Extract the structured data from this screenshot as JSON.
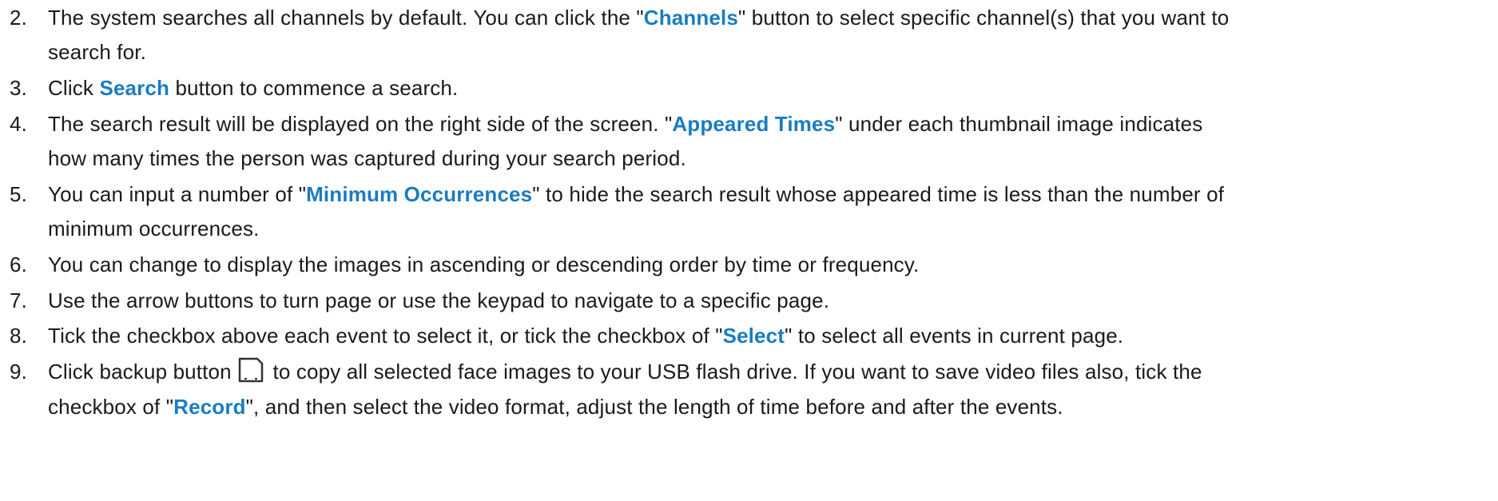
{
  "steps": [
    {
      "num": "2.",
      "a": "The system searches all channels by default. You can click the \"",
      "b": "Channels",
      "c": "\" button to select specific channel(s) that you want to",
      "d": "search for."
    },
    {
      "num": "3.",
      "a": "Click ",
      "b": "Search",
      "c": " button to commence a search."
    },
    {
      "num": "4.",
      "a": "The search result will be displayed on the right side of the screen. \"",
      "b": "Appeared Times",
      "c": "\" under each thumbnail image indicates",
      "d": "how many times the person was captured during your search period."
    },
    {
      "num": "5.",
      "a": "You can input a number of \"",
      "b": "Minimum Occurrences",
      "c": "\" to hide the search result whose appeared time is less than the number of",
      "d": "minimum occurrences."
    },
    {
      "num": "6.",
      "a": "You can change to display the images in ascending or descending order by time or frequency."
    },
    {
      "num": "7.",
      "a": "Use the arrow buttons to turn page or use the keypad to navigate to a specific page."
    },
    {
      "num": "8.",
      "a": "Tick the checkbox above each event to select it, or tick the checkbox of \"",
      "b": "Select",
      "c": "\" to select all events in current page."
    },
    {
      "num": "9.",
      "a": "Click backup button ",
      "icon": "save-disk-icon",
      "c": " to copy all selected face images to your USB flash drive. If you want to save video files also, tick the",
      "d": "checkbox of \"",
      "e": "Record",
      "f": "\", and then select the video format, adjust the length of time before and after the events."
    }
  ],
  "colors": {
    "highlight": "#1a7cc1",
    "text": "#1a1a1a"
  }
}
